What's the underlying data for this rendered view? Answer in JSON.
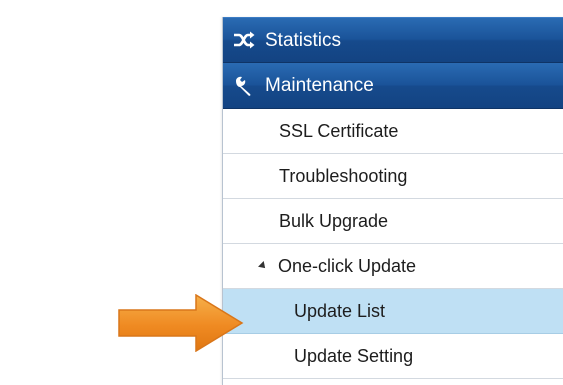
{
  "menu": {
    "headers": [
      {
        "label": "Statistics",
        "icon": "shuffle-icon"
      },
      {
        "label": "Maintenance",
        "icon": "wrench-icon"
      }
    ],
    "items": [
      {
        "label": "SSL Certificate"
      },
      {
        "label": "Troubleshooting"
      },
      {
        "label": "Bulk Upgrade"
      },
      {
        "label": "One-click Update",
        "expanded": true
      }
    ],
    "children": [
      {
        "label": "Update List",
        "selected": true
      },
      {
        "label": "Update Setting"
      }
    ]
  },
  "colors": {
    "header_bg": "#1a5399",
    "selected_bg": "#bfe0f4",
    "arrow": "#f0902a"
  },
  "callout": {
    "icon": "arrow-right-icon"
  }
}
